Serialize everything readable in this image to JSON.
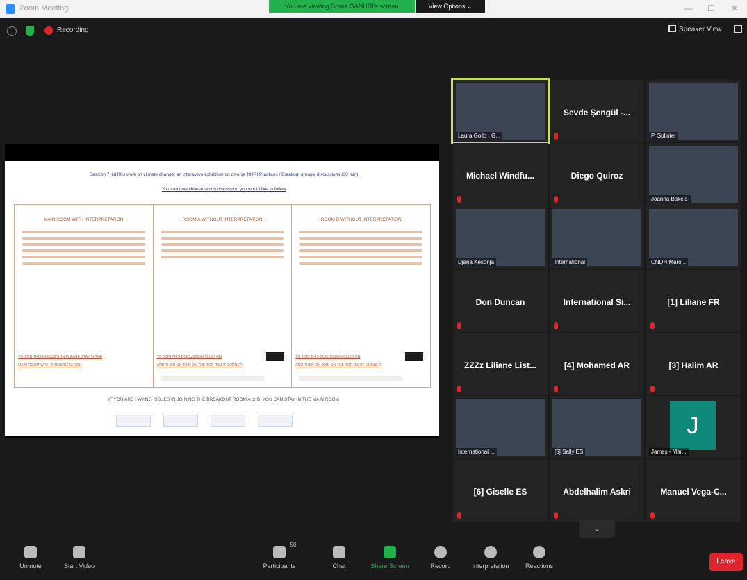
{
  "window": {
    "title": "Zoom Meeting"
  },
  "banner": {
    "share_text": "You are viewing Soraa GANHRI's screen",
    "view_options": "View Options ⌄"
  },
  "topbar": {
    "recording_label": "Recording",
    "speaker_view": "Speaker View"
  },
  "slide": {
    "title": "Session 7: NHRIs work on climate change: an interactive exhibition on diverse NHRI Practices / Breakout groups' discussions (30 min)",
    "subtitle": "You can now choose which discussion you would like to follow",
    "columns": [
      {
        "header": "MAIN ROOM WITH INTERPRETATION",
        "join": "TO JOIN THIS DISCUSSION PLEASE STAY IN THE",
        "join2": "MAIN ROOM WITH INTERPRETATION"
      },
      {
        "header": "ROOM A WITHOUT INTERPRETATION",
        "join": "TO JOIN THIS DISCUSSION CLICK ON",
        "join2": "AND THEN ON JOIN ON THE TOP RIGHT CORNER"
      },
      {
        "header": "ROOM B WITHOUT INTERPRETATION",
        "join": "TO JOIN THIS DISCUSSION CLICK ON",
        "join2": "AND THEN ON JOIN ON THE TOP RIGHT CORNER"
      }
    ],
    "issue": "IF YOU ARE HAVING ISSUES IN JOINING THE BREAKOUT ROOM A or B, YOU CAN STAY IN THE MAIN ROOM"
  },
  "tiles": [
    {
      "name": "Laura Gollo : G...",
      "type": "video"
    },
    {
      "name": "Sevde Şengül -...",
      "type": "name"
    },
    {
      "name": "P. Splinter",
      "type": "video"
    },
    {
      "name": "Michael Windfu...",
      "type": "name"
    },
    {
      "name": "Diego Quiroz",
      "type": "name"
    },
    {
      "name": "Joanna Bakels-",
      "type": "video"
    },
    {
      "name": "Djana Kesonja",
      "type": "video"
    },
    {
      "name": "International",
      "type": "video"
    },
    {
      "name": "CNDH Maro...",
      "type": "video"
    },
    {
      "name": "Don Duncan",
      "type": "name"
    },
    {
      "name": "International Si...",
      "type": "name"
    },
    {
      "name": "[1] Liliane FR",
      "type": "name"
    },
    {
      "name": "ZZZz Liliane List...",
      "type": "name"
    },
    {
      "name": "[4] Mohamed AR",
      "type": "name"
    },
    {
      "name": "[3] Halim AR",
      "type": "name"
    },
    {
      "name": "International ...",
      "type": "video"
    },
    {
      "name": "[5] Sally ES",
      "type": "video"
    },
    {
      "name": "James - Mar...",
      "type": "avatar"
    },
    {
      "name": "[6] Giselle ES",
      "type": "name"
    },
    {
      "name": "Abdelhalim Askri",
      "type": "name"
    },
    {
      "name": "Manuel Vega-C...",
      "type": "name"
    }
  ],
  "toolbar": {
    "unmute": "Unmute",
    "start_video": "Start Video",
    "participants": "Participants",
    "participants_count": "50",
    "chat": "Chat",
    "share_screen": "Share Screen",
    "record": "Record",
    "interpretation": "Interpretation",
    "reactions": "Reactions",
    "leave": "Leave"
  }
}
